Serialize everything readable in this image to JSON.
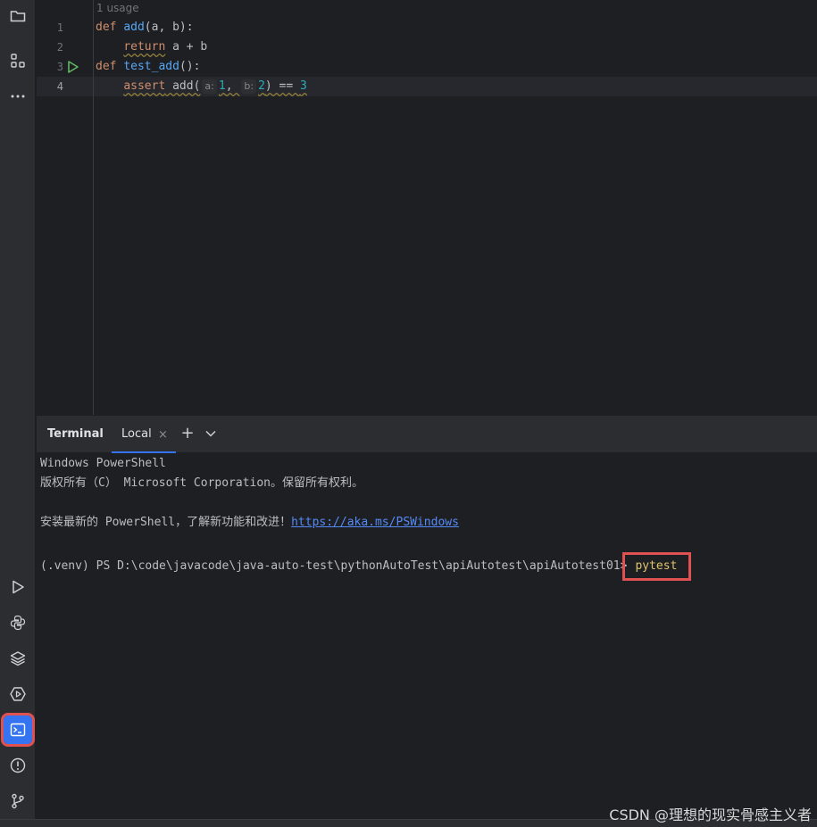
{
  "editor": {
    "usage_hint": "1 usage",
    "line_numbers": [
      "1",
      "2",
      "3",
      "4"
    ],
    "lines": {
      "l1": {
        "kw": "def",
        "fn": "add",
        "rest": "(a, b):"
      },
      "l2": {
        "indent": "    ",
        "kw": "return",
        "rest": " a + b"
      },
      "l3": {
        "kw": "def",
        "fn": "test_add",
        "rest": "():"
      },
      "l4": {
        "indent": "    ",
        "kw": "assert",
        "call": " add(",
        "hint_a": "a:",
        "arg_a": "1",
        "comma": ", ",
        "hint_b": "b:",
        "arg_b": "2",
        "close": ")",
        "op": " == ",
        "expected": "3"
      }
    }
  },
  "terminal": {
    "title": "Terminal",
    "tab_label": "Local",
    "tab_close": "×",
    "add_tab": "+",
    "lines": {
      "l1": "Windows PowerShell",
      "l2": "版权所有（C） Microsoft Corporation。保留所有权利。",
      "l3_text": "安装最新的 PowerShell，了解新功能和改进！",
      "l3_link": "https://aka.ms/PSWindows",
      "prompt": "(.venv) PS D:\\code\\javacode\\java-auto-test\\pythonAutoTest\\apiAutotest\\apiAutotest01>",
      "command": "pytest"
    }
  },
  "watermark": "CSDN @理想的现实骨感主义者",
  "colors": {
    "accent": "#3574f0",
    "highlight_box": "#e05252",
    "keyword": "#cf8e6d",
    "function": "#56a8f5",
    "number": "#2aacb8"
  },
  "icons": {
    "strip_top": [
      "folder-icon",
      "structure-icon",
      "more-icon"
    ],
    "strip_bottom": [
      "run-icon",
      "python-console-icon",
      "layers-icon",
      "services-icon",
      "terminal-icon",
      "problems-icon",
      "git-icon"
    ]
  }
}
